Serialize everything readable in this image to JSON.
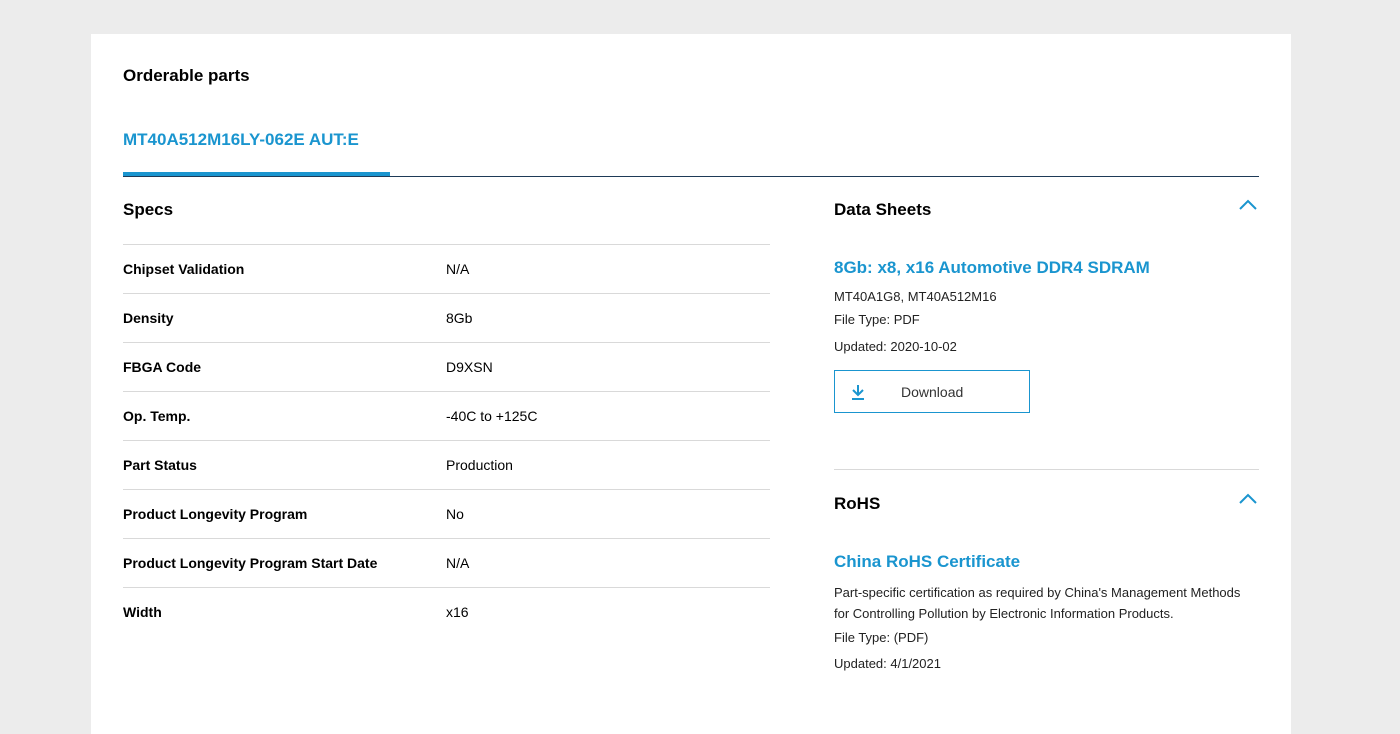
{
  "page": {
    "section_title": "Orderable parts"
  },
  "tabs": [
    {
      "label": "MT40A512M16LY-062E AUT:E",
      "active": true
    }
  ],
  "specs": {
    "title": "Specs",
    "rows": [
      {
        "label": "Chipset Validation",
        "value": "N/A"
      },
      {
        "label": "Density",
        "value": "8Gb"
      },
      {
        "label": "FBGA Code",
        "value": "D9XSN"
      },
      {
        "label": "Op. Temp.",
        "value": "-40C to +125C"
      },
      {
        "label": "Part Status",
        "value": "Production"
      },
      {
        "label": "Product Longevity Program",
        "value": "No"
      },
      {
        "label": "Product Longevity Program Start Date",
        "value": "N/A"
      },
      {
        "label": "Width",
        "value": "x16"
      }
    ]
  },
  "data_sheets": {
    "title": "Data Sheets",
    "toggle_icon": "chevron-up-icon",
    "document": {
      "title": "8Gb: x8, x16 Automotive DDR4 SDRAM",
      "parts": "MT40A1G8, MT40A512M16",
      "file_type": "File Type: PDF",
      "updated": "Updated: 2020-10-02",
      "download_label": "Download",
      "download_icon": "download-icon"
    }
  },
  "rohs": {
    "title": "RoHS",
    "toggle_icon": "chevron-up-icon",
    "document": {
      "title": "China RoHS Certificate",
      "description": "Part-specific certification as required by China's Management Methods for Controlling Pollution by Electronic Information Products.",
      "file_type": "File Type: (PDF)",
      "updated": "Updated: 4/1/2021"
    }
  },
  "colors": {
    "accent": "#1a95cf",
    "background": "#ececec",
    "card": "#ffffff",
    "divider": "#d9d9d9"
  }
}
